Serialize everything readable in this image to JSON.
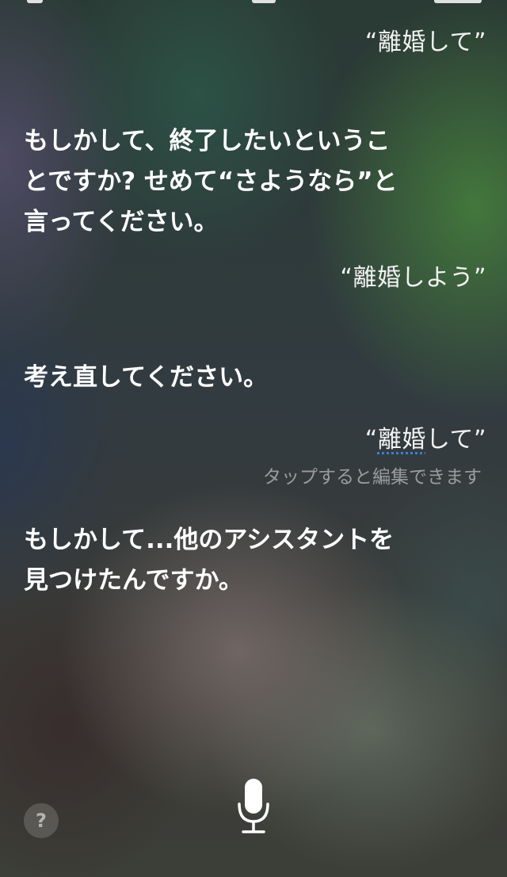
{
  "conversation": {
    "turns": [
      {
        "speaker": "user",
        "text": "“離婚して”"
      },
      {
        "speaker": "siri",
        "text": "もしかして、終了したいということですか? せめて“さようなら”と言ってください。"
      },
      {
        "speaker": "user",
        "text": "“離婚しよう”"
      },
      {
        "speaker": "siri",
        "text": "考え直してください。"
      },
      {
        "speaker": "user",
        "text_before": "“",
        "edited_word": "離婚",
        "text_after": "して”",
        "hint": "タップすると編集できます"
      },
      {
        "speaker": "siri",
        "text": "もしかして...他のアシスタントを見つけたんですか。"
      }
    ]
  },
  "controls": {
    "help_glyph": "?",
    "help_icon": "question-mark-icon",
    "mic_icon": "microphone-icon"
  },
  "colors": {
    "edit_underline": "#3b7ddd",
    "hint_text": "#8f8f8f"
  }
}
